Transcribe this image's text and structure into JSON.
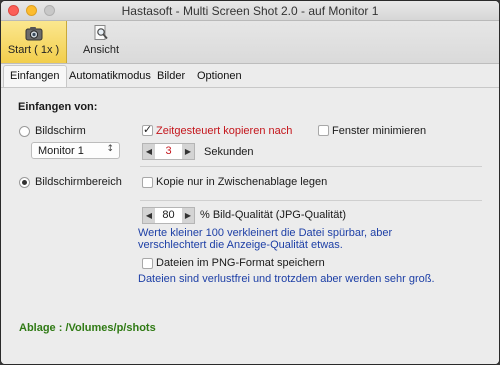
{
  "window": {
    "title": "Hastasoft - Multi Screen Shot 2.0 - auf Monitor 1"
  },
  "toolbar": {
    "start_label": "Start ( 1x )",
    "view_label": "Ansicht",
    "start_icon": "camera-icon",
    "view_icon": "magnifier-document-icon"
  },
  "tabs": [
    {
      "label": "Einfangen",
      "active": true
    },
    {
      "label": "Automatikmodus",
      "active": false
    },
    {
      "label": "Bilder",
      "active": false
    },
    {
      "label": "Optionen",
      "active": false
    }
  ],
  "capture": {
    "heading": "Einfangen von:",
    "screen_radio_label": "Bildschirm",
    "screen_radio_selected": false,
    "monitor_select_value": "Monitor 1",
    "area_radio_label": "Bildschirmbereich",
    "area_radio_selected": true
  },
  "timed": {
    "label": "Zeitgesteuert kopieren nach",
    "checked": true,
    "seconds_value": "3",
    "seconds_label": "Sekunden"
  },
  "minimize": {
    "label": "Fenster minimieren",
    "checked": false
  },
  "clipboard": {
    "label": "Kopie nur in Zwischenablage legen",
    "checked": false
  },
  "quality": {
    "value": "80",
    "label": "% Bild-Qualität (JPG-Qualität)",
    "hint_line1": "Werte kleiner 100 verkleinert die Datei  spürbar, aber",
    "hint_line2": "verschlechtert die Anzeige-Qualität etwas."
  },
  "png": {
    "label": "Dateien im PNG-Format speichern",
    "checked": false,
    "hint": "Dateien sind verlustfrei und trotzdem aber werden sehr groß."
  },
  "storage": {
    "text": "Ablage : /Volumes/p/shots"
  },
  "colors": {
    "accent_start": "#f2ce4c",
    "red_label": "#c4161c",
    "blue_hint": "#1d3fa6",
    "green_path": "#2f7a14"
  }
}
